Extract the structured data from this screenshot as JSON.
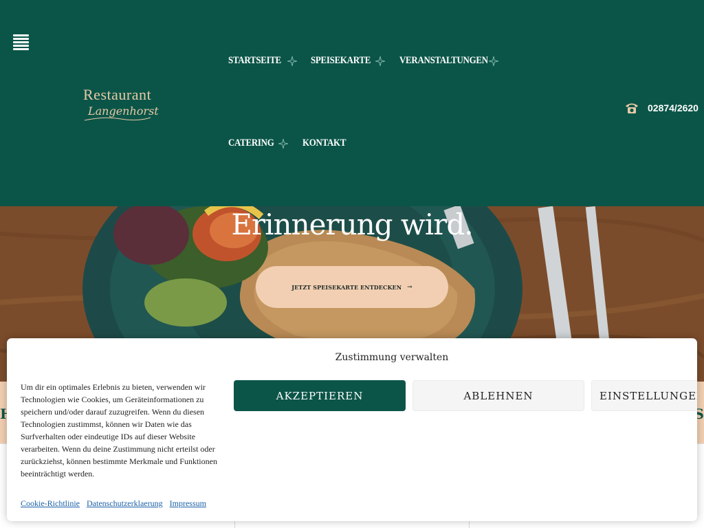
{
  "header": {
    "brand_top": "Restaurant",
    "brand_bottom": "Langenhorst",
    "nav": [
      {
        "label": "STARTSEITE"
      },
      {
        "label": "SPEISEKARTE"
      },
      {
        "label": "VERANSTALTUNGEN"
      },
      {
        "label": "CATERING"
      },
      {
        "label": "KONTAKT"
      }
    ],
    "phone": "02874/2620",
    "bg_color": "#0b5548"
  },
  "hero": {
    "title": "Erinnerung wird.",
    "cta_label": "JETZT SPEISEKARTE ENTDECKEN",
    "cta_arrow": "→",
    "cta_color": "#f2cfb2"
  },
  "strip": {
    "left_fragment": "H",
    "right_fragment": "S"
  },
  "cookie": {
    "title": "Zustimmung verwalten",
    "text": "Um dir ein optimales Erlebnis zu bieten, verwenden wir Technologien wie Cookies, um Geräteinformationen zu speichern und/oder darauf zuzugreifen. Wenn du diesen Technologien zustimmst, können wir Daten wie das Surfverhalten oder eindeutige IDs auf dieser Website verarbeiten. Wenn du deine Zustimmung nicht erteilst oder zurückziehst, können bestimmte Merkmale und Funktionen beeinträchtigt werden.",
    "accept_label": "AKZEPTIEREN",
    "deny_label": "ABLEHNEN",
    "settings_label": "EINSTELLUNGEN A",
    "links": [
      "Cookie-Richtlinie",
      "Datenschutzerklaerung",
      "Impressum"
    ],
    "accent_color": "#0b5548",
    "link_color": "#1a5fa8"
  }
}
